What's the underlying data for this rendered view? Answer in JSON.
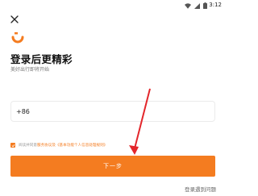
{
  "status_bar": {
    "time": "3:12",
    "icons": [
      "wifi-icon",
      "signal-icon",
      "battery-icon"
    ]
  },
  "header": {
    "close_icon": "close-icon",
    "logo_icon": "app-logo-icon"
  },
  "main": {
    "title": "登录后更精彩",
    "subtitle": "美好出行即将开始"
  },
  "phone": {
    "prefix": "+86",
    "value": "",
    "placeholder": ""
  },
  "agreement": {
    "checked": true,
    "text": "阅读并同意",
    "links": "服务协议及《基本功能个人信息处理规则》"
  },
  "next_button": {
    "label": "下一步"
  },
  "help_link": {
    "label": "登录遇到问题"
  },
  "colors": {
    "accent": "#f47c20",
    "annotation": "#e3262b"
  }
}
